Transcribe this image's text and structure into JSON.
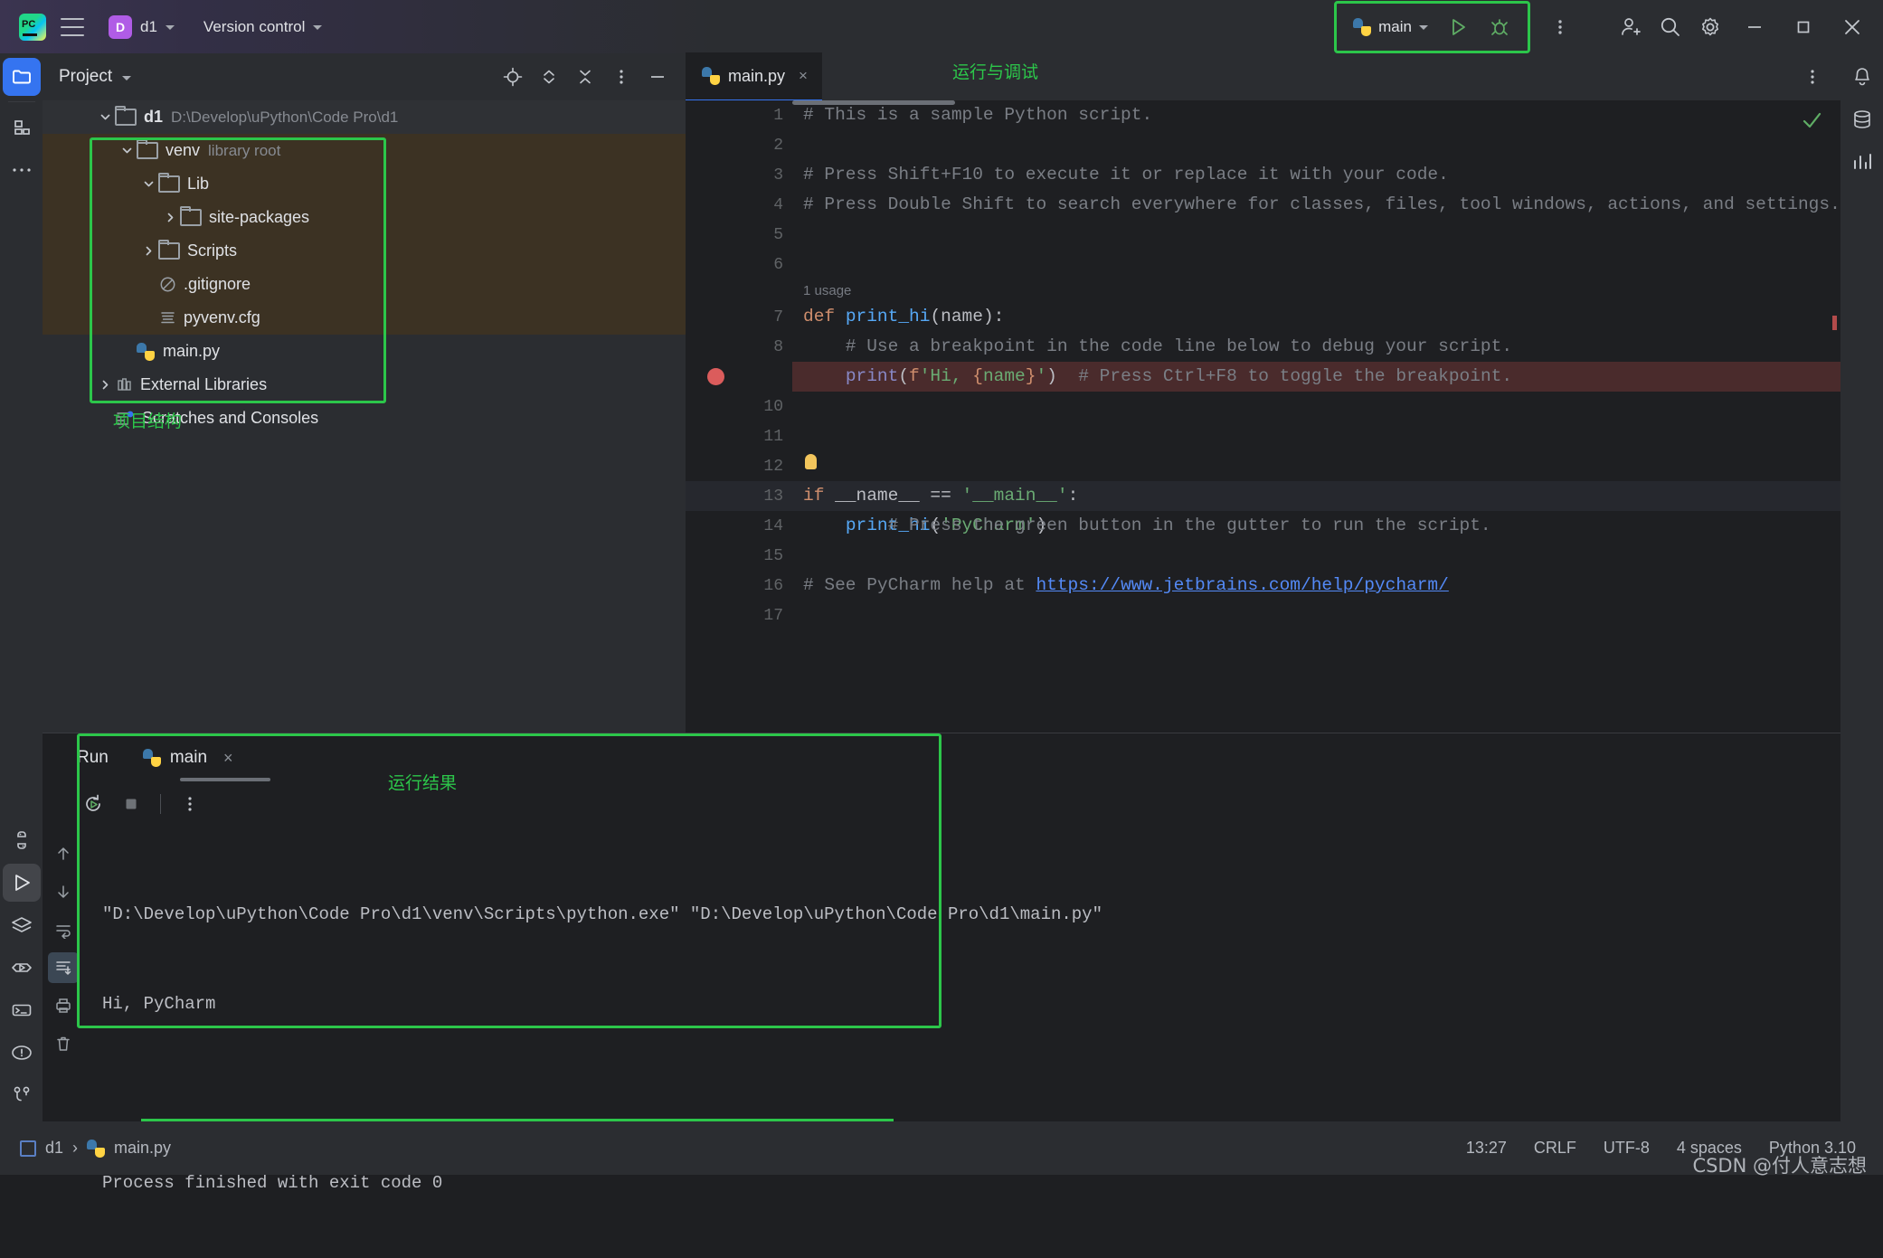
{
  "titlebar": {
    "menu_icon": "hamburger-icon",
    "project_badge": "D",
    "project_name": "d1",
    "vcs_label": "Version control",
    "run_config": "main",
    "icons": {
      "run": "run-icon",
      "debug": "debug-icon",
      "more": "more-vertical-icon",
      "share": "add-user-icon",
      "search": "search-icon",
      "settings": "gear-icon",
      "minimize": "minimize-icon",
      "maximize": "maximize-icon",
      "close": "close-icon"
    }
  },
  "annotations": {
    "run_debug": "运行与调试",
    "project_structure": "项目结构",
    "run_result": "运行结果",
    "accent": "#2cc64a"
  },
  "project_panel": {
    "title": "Project",
    "tree": [
      {
        "label": "d1",
        "suffix": "D:\\Develop\\uPython\\Code Pro\\d1",
        "indent": 0,
        "twisty": "down",
        "icon": "folder-icon",
        "state": "selected"
      },
      {
        "label": "venv",
        "suffix": "library root",
        "indent": 1,
        "twisty": "down",
        "icon": "folder-icon",
        "state": "excluded"
      },
      {
        "label": "Lib",
        "suffix": "",
        "indent": 2,
        "twisty": "down",
        "icon": "folder-icon",
        "state": "excluded"
      },
      {
        "label": "site-packages",
        "suffix": "",
        "indent": 3,
        "twisty": "right",
        "icon": "folder-icon",
        "state": "excluded"
      },
      {
        "label": "Scripts",
        "suffix": "",
        "indent": 2,
        "twisty": "right",
        "icon": "folder-icon",
        "state": "excluded"
      },
      {
        "label": ".gitignore",
        "suffix": "",
        "indent": 2,
        "twisty": "none",
        "icon": "ignored-file-icon",
        "state": "excluded"
      },
      {
        "label": "pyvenv.cfg",
        "suffix": "",
        "indent": 2,
        "twisty": "none",
        "icon": "config-file-icon",
        "state": "excluded"
      },
      {
        "label": "main.py",
        "suffix": "",
        "indent": 1,
        "twisty": "none",
        "icon": "python-file-icon",
        "state": "normal"
      },
      {
        "label": "External Libraries",
        "suffix": "",
        "indent": 0,
        "twisty": "right",
        "icon": "libraries-icon",
        "state": "normal"
      },
      {
        "label": "Scratches and Consoles",
        "suffix": "",
        "indent": 0,
        "twisty": "none",
        "icon": "scratches-icon",
        "state": "normal"
      }
    ],
    "header_icons": [
      "locate-icon",
      "expand-collapse-icon",
      "collapse-all-icon",
      "more-vertical-icon",
      "hide-icon"
    ]
  },
  "editor": {
    "tab": {
      "label": "main.py",
      "icon": "python-file-icon",
      "close": "×"
    },
    "more_icon": "more-vertical-icon",
    "inspection_status": "ok-check-icon",
    "usage_label": "1 usage",
    "ghost_line": "if __name__ == '__main__':",
    "lines": [
      {
        "n": "1",
        "text": "# This is a sample Python script."
      },
      {
        "n": "2",
        "text": ""
      },
      {
        "n": "3",
        "text": "# Press Shift+F10 to execute it or replace it with your code."
      },
      {
        "n": "4",
        "text": "# Press Double Shift to search everywhere for classes, files, tool windows, actions, and settings."
      },
      {
        "n": "5",
        "text": ""
      },
      {
        "n": "6",
        "text": ""
      },
      {
        "n": "7",
        "text": "def print_hi(name):"
      },
      {
        "n": "8",
        "text": "    # Use a breakpoint in the code line below to debug your script."
      },
      {
        "n": "9",
        "text": "    print(f'Hi, {name}')  # Press Ctrl+F8 to toggle the breakpoint.",
        "breakpoint": true
      },
      {
        "n": "10",
        "text": ""
      },
      {
        "n": "11",
        "text": ""
      },
      {
        "n": "12",
        "text": "# Press the green button in the gutter to run the script."
      },
      {
        "n": "13",
        "text": "if __name__ == '__main__':",
        "gutter_run": true
      },
      {
        "n": "14",
        "text": "    print_hi('PyCharm')"
      },
      {
        "n": "15",
        "text": ""
      },
      {
        "n": "16",
        "text": "# See PyCharm help at https://www.jetbrains.com/help/pycharm/"
      },
      {
        "n": "17",
        "text": ""
      }
    ],
    "help_url": "https://www.jetbrains.com/help/pycharm/"
  },
  "run_panel": {
    "title": "Run",
    "tab_label": "main",
    "tab_icon": "python-file-icon",
    "tab_close": "×",
    "toolbar": [
      "rerun-icon",
      "stop-icon",
      "more-vertical-icon"
    ],
    "side_rail": [
      "up-arrow-icon",
      "down-arrow-icon",
      "soft-wrap-icon",
      "scroll-to-end-icon",
      "print-icon",
      "trash-icon"
    ],
    "console": [
      "\"D:\\Develop\\uPython\\Code Pro\\d1\\venv\\Scripts\\python.exe\" \"D:\\Develop\\uPython\\Code Pro\\d1\\main.py\"",
      "Hi, PyCharm",
      "",
      "Process finished with exit code 0"
    ]
  },
  "status_bar": {
    "breadcrumb_project": "d1",
    "breadcrumb_sep": "›",
    "breadcrumb_file": "main.py",
    "caret_position": "13:27",
    "line_separator": "CRLF",
    "encoding": "UTF-8",
    "indent": "4 spaces",
    "interpreter": "Python 3.10",
    "watermark": "CSDN @付人意志想"
  }
}
